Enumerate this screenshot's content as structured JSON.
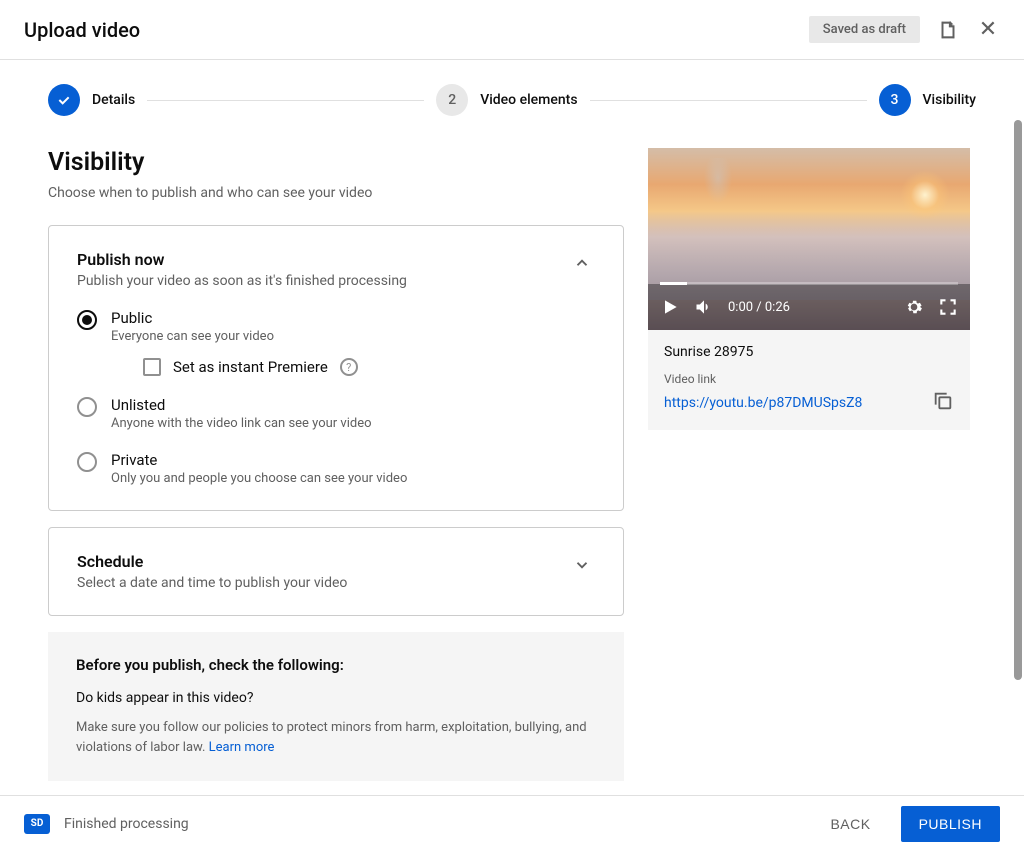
{
  "header": {
    "title": "Upload video",
    "saved_badge": "Saved as draft"
  },
  "stepper": {
    "step1": {
      "label": "Details"
    },
    "step2": {
      "num": "2",
      "label": "Video elements"
    },
    "step3": {
      "num": "3",
      "label": "Visibility"
    }
  },
  "page": {
    "title": "Visibility",
    "subtitle": "Choose when to publish and who can see your video"
  },
  "publish_now": {
    "title": "Publish now",
    "subtitle": "Publish your video as soon as it's finished processing",
    "options": {
      "public": {
        "label": "Public",
        "desc": "Everyone can see your video"
      },
      "premiere_label": "Set as instant Premiere",
      "unlisted": {
        "label": "Unlisted",
        "desc": "Anyone with the video link can see your video"
      },
      "private": {
        "label": "Private",
        "desc": "Only you and people you choose can see your video"
      }
    }
  },
  "schedule": {
    "title": "Schedule",
    "subtitle": "Select a date and time to publish your video"
  },
  "info": {
    "title": "Before you publish, check the following:",
    "question": "Do kids appear in this video?",
    "text": "Make sure you follow our policies to protect minors from harm, exploitation, bullying, and violations of labor law. ",
    "link": "Learn more"
  },
  "preview": {
    "time": "0:00 / 0:26",
    "title": "Sunrise 28975",
    "link_label": "Video link",
    "link": "https://youtu.be/p87DMUSpsZ8"
  },
  "footer": {
    "sd": "SD",
    "status": "Finished processing",
    "back": "BACK",
    "publish": "PUBLISH"
  }
}
